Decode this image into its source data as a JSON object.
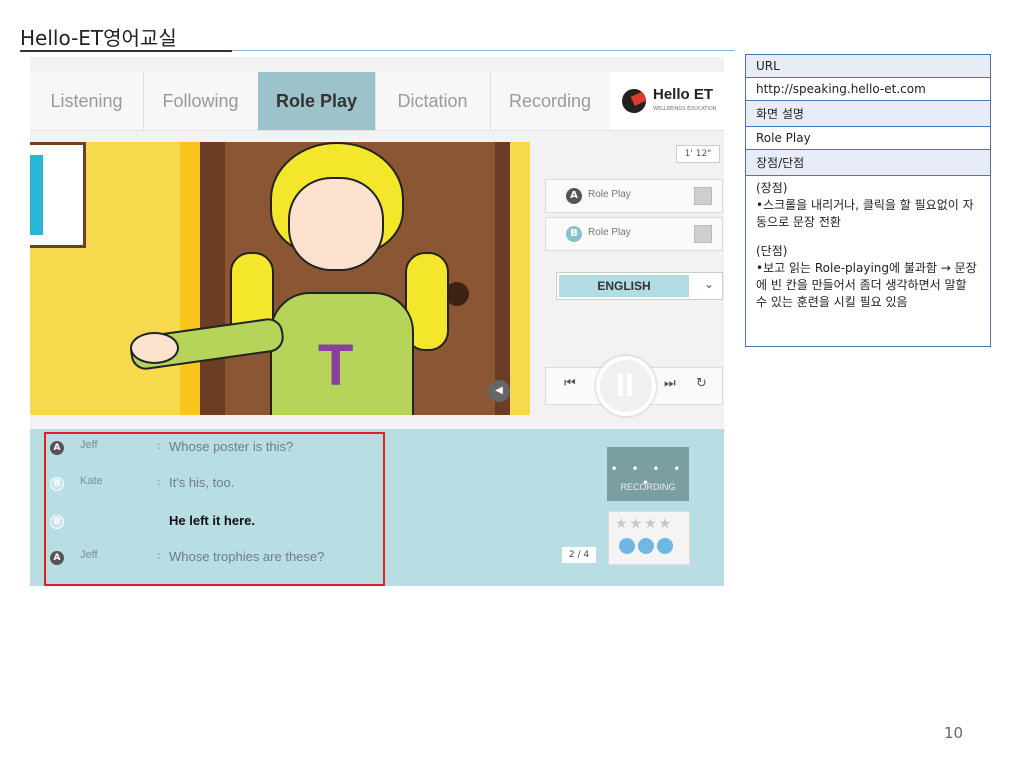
{
  "slide": {
    "title": "Hello-ET영어교실",
    "page_number": "10"
  },
  "app": {
    "tabs": [
      {
        "label": "Listening",
        "active": false
      },
      {
        "label": "Following",
        "active": false
      },
      {
        "label": "Role Play",
        "active": true
      },
      {
        "label": "Dictation",
        "active": false
      },
      {
        "label": "Recording",
        "active": false
      }
    ],
    "logo": {
      "text": "Hello ET",
      "sub": "WELLBEINGS EDUCATION"
    },
    "timer": "1' 12\"",
    "roles": [
      {
        "badge": "A",
        "label": "Role Play"
      },
      {
        "badge": "B",
        "label": "Role Play"
      }
    ],
    "language": "ENGLISH",
    "player": {
      "prev": "⏮",
      "next": "⏭",
      "repeat": "↻"
    },
    "sound_icon": "◀",
    "dialogue": [
      {
        "badge": "A",
        "speaker": "Jeff",
        "text": "Whose poster is this?",
        "current": false
      },
      {
        "badge": "B",
        "speaker": "Kate",
        "text": "It's his, too.",
        "current": false
      },
      {
        "badge": "B",
        "speaker": "",
        "text": "He left it here.",
        "current": true
      },
      {
        "badge": "A",
        "speaker": "Jeff",
        "text": "Whose trophies are these?",
        "current": false
      }
    ],
    "recording": {
      "dots": "• • • • •",
      "label": "RECORDING"
    },
    "stars": "★★★★",
    "page_counter": "2 / 4",
    "colors": {
      "active_tab": "#9cc3c9",
      "dialogue_bg": "#b8dde3",
      "highlight": "#e11f1f"
    }
  },
  "info_table": {
    "url_label": "URL",
    "url_value": "http://speaking.hello-et.com",
    "desc_label": "화면 설명",
    "desc_value": "Role Play",
    "proscons_label": "장점/단점",
    "pros_heading": "(장점)",
    "pros_text": "•스크롤을 내리거나, 클릭을 할 필요없이 자동으로 문장 전환",
    "cons_heading": "(단점)",
    "cons_text": "•보고 읽는 Role-playing에 불과함 → 문장에 빈 칸을 만들어서 좀더 생각하면서 말할 수 있는 훈련을 시킬 필요 있음"
  }
}
